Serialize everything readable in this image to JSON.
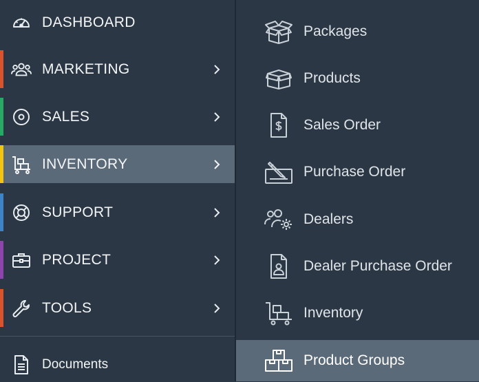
{
  "main_menu": {
    "items": [
      {
        "label": "DASHBOARD",
        "icon": "dashboard-gauge-icon",
        "accent": "",
        "has_submenu": false
      },
      {
        "label": "MARKETING",
        "icon": "users-group-icon",
        "accent": "#d9532c",
        "has_submenu": true
      },
      {
        "label": "SALES",
        "icon": "target-circle-icon",
        "accent": "#27a865",
        "has_submenu": true
      },
      {
        "label": "INVENTORY",
        "icon": "cart-boxes-icon",
        "accent": "#f2c512",
        "has_submenu": true,
        "active": true
      },
      {
        "label": "SUPPORT",
        "icon": "lifebuoy-icon",
        "accent": "#3c84c6",
        "has_submenu": true
      },
      {
        "label": "PROJECT",
        "icon": "briefcase-icon",
        "accent": "#8e44ad",
        "has_submenu": true
      },
      {
        "label": "TOOLS",
        "icon": "wrench-icon",
        "accent": "#d9532c",
        "has_submenu": true
      }
    ],
    "documents_label": "Documents"
  },
  "submenu": {
    "items": [
      {
        "label": "Packages",
        "icon": "open-box-icon"
      },
      {
        "label": "Products",
        "icon": "box-icon"
      },
      {
        "label": "Sales Order",
        "icon": "invoice-dollar-icon"
      },
      {
        "label": "Purchase Order",
        "icon": "signature-pen-icon"
      },
      {
        "label": "Dealers",
        "icon": "users-gear-icon"
      },
      {
        "label": "Dealer Purchase Order",
        "icon": "id-badge-document-icon"
      },
      {
        "label": "Inventory",
        "icon": "cart-boxes-icon"
      },
      {
        "label": "Product Groups",
        "icon": "stacked-boxes-icon",
        "active": true
      }
    ]
  },
  "colors": {
    "panel_bg": "#2b3744",
    "active_bg": "#5b6a78",
    "text": "#f3f5f7",
    "icon_stroke": "#c9d1d9"
  }
}
